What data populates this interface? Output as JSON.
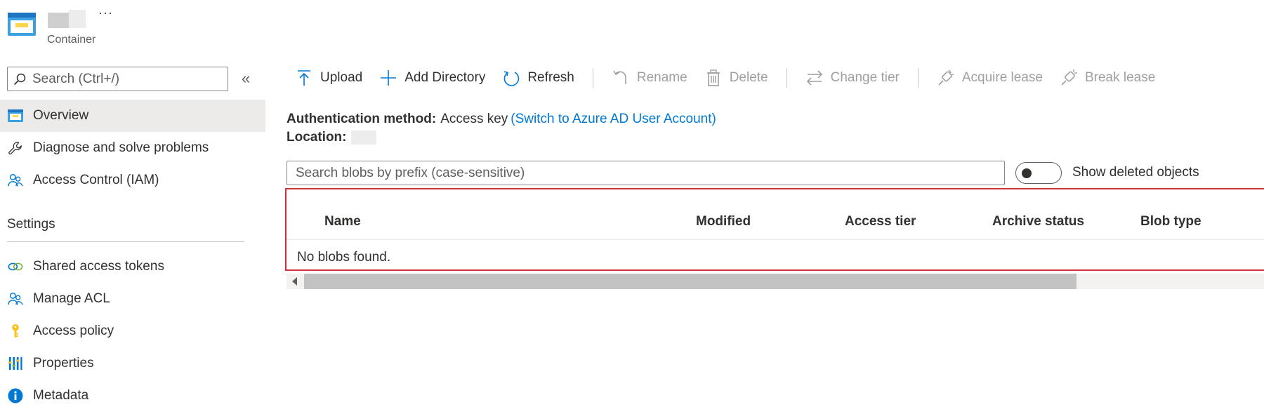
{
  "header": {
    "subtitle": "Container",
    "more": "···"
  },
  "sidebar": {
    "search_placeholder": "Search (Ctrl+/)",
    "collapse": "«",
    "items": [
      {
        "label": "Overview",
        "icon": "container-icon",
        "active": true
      },
      {
        "label": "Diagnose and solve problems",
        "icon": "wrench-icon"
      },
      {
        "label": "Access Control (IAM)",
        "icon": "people-icon"
      }
    ],
    "settings_header": "Settings",
    "settings_items": [
      {
        "label": "Shared access tokens",
        "icon": "link-icon"
      },
      {
        "label": "Manage ACL",
        "icon": "people-icon"
      },
      {
        "label": "Access policy",
        "icon": "key-icon"
      },
      {
        "label": "Properties",
        "icon": "bars-icon"
      },
      {
        "label": "Metadata",
        "icon": "info-icon"
      }
    ]
  },
  "toolbar": {
    "upload": "Upload",
    "add_directory": "Add Directory",
    "refresh": "Refresh",
    "rename": "Rename",
    "delete": "Delete",
    "change_tier": "Change tier",
    "acquire_lease": "Acquire lease",
    "break_lease": "Break lease"
  },
  "info": {
    "auth_label": "Authentication method:",
    "auth_value": "Access key",
    "auth_link": "(Switch to Azure AD User Account)",
    "location_label": "Location:"
  },
  "blobs": {
    "search_placeholder": "Search blobs by prefix (case-sensitive)",
    "toggle_label": "Show deleted objects",
    "toggle_on": false,
    "columns": [
      "Name",
      "Modified",
      "Access tier",
      "Archive status",
      "Blob type"
    ],
    "empty_text": "No blobs found."
  },
  "colors": {
    "accent": "#0078d4",
    "highlight_border": "#d13438",
    "active_nav": "#edebe9"
  }
}
